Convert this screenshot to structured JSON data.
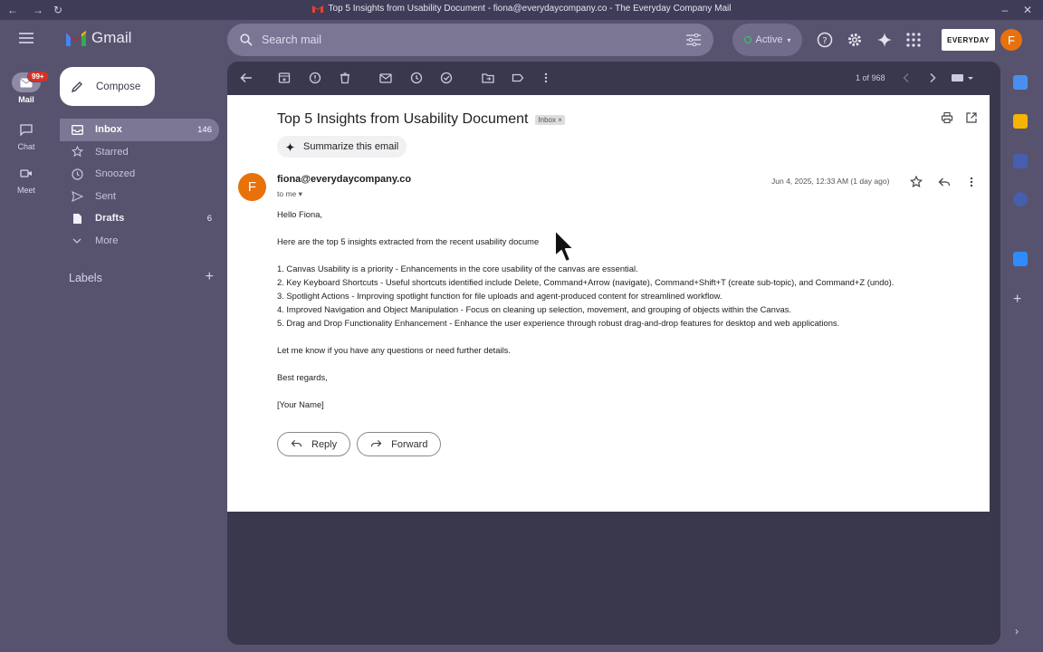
{
  "window": {
    "title": "Top 5 Insights from Usability Document - fiona@everydaycompany.co - The Everyday Company Mail"
  },
  "app": {
    "name": "Gmail",
    "search_placeholder": "Search mail",
    "status": "Active",
    "brand": "EVERYDAY",
    "avatar_letter": "F"
  },
  "rail": {
    "mail": "Mail",
    "mail_badge": "99+",
    "chat": "Chat",
    "meet": "Meet"
  },
  "sidebar": {
    "compose": "Compose",
    "items": [
      {
        "label": "Inbox",
        "count": "146",
        "icon": "inbox-icon"
      },
      {
        "label": "Starred",
        "count": "",
        "icon": "star-icon"
      },
      {
        "label": "Snoozed",
        "count": "",
        "icon": "clock-icon"
      },
      {
        "label": "Sent",
        "count": "",
        "icon": "send-icon"
      },
      {
        "label": "Drafts",
        "count": "6",
        "icon": "draft-icon"
      },
      {
        "label": "More",
        "count": "",
        "icon": "chevron-down-icon"
      }
    ],
    "labels_heading": "Labels"
  },
  "toolbar": {
    "pager": "1 of 968"
  },
  "email": {
    "subject": "Top 5 Insights from Usability Document",
    "label_chip": "Inbox",
    "summarize": "Summarize this email",
    "sender": "fiona@everydaycompany.co",
    "sender_initial": "F",
    "to": "to me",
    "date": "Jun 4, 2025, 12:33 AM (1 day ago)",
    "greeting": "Hello Fiona,",
    "intro": "Here are the top 5 insights extracted from the recent usability docume",
    "points": [
      "1. Canvas Usability is a priority - Enhancements in the core usability of the canvas are essential.",
      "2. Key Keyboard Shortcuts - Useful shortcuts identified include Delete, Command+Arrow (navigate), Command+Shift+T (create sub-topic), and Command+Z (undo).",
      "3. Spotlight Actions - Improving spotlight function for file uploads and agent-produced content for streamlined workflow.",
      "4. Improved Navigation and Object Manipulation - Focus on cleaning up selection, movement, and grouping of objects within the Canvas.",
      "5. Drag and Drop Functionality Enhancement - Enhance the user experience through robust drag-and-drop features for desktop and web applications."
    ],
    "closing": "Let me know if you have any questions or need further details.",
    "regards": "Best regards,",
    "signature": "[Your Name]",
    "reply": "Reply",
    "forward": "Forward"
  },
  "colors": {
    "frame": "#57536f",
    "accent_avatar": "#e8710a",
    "badge": "#d93025"
  }
}
